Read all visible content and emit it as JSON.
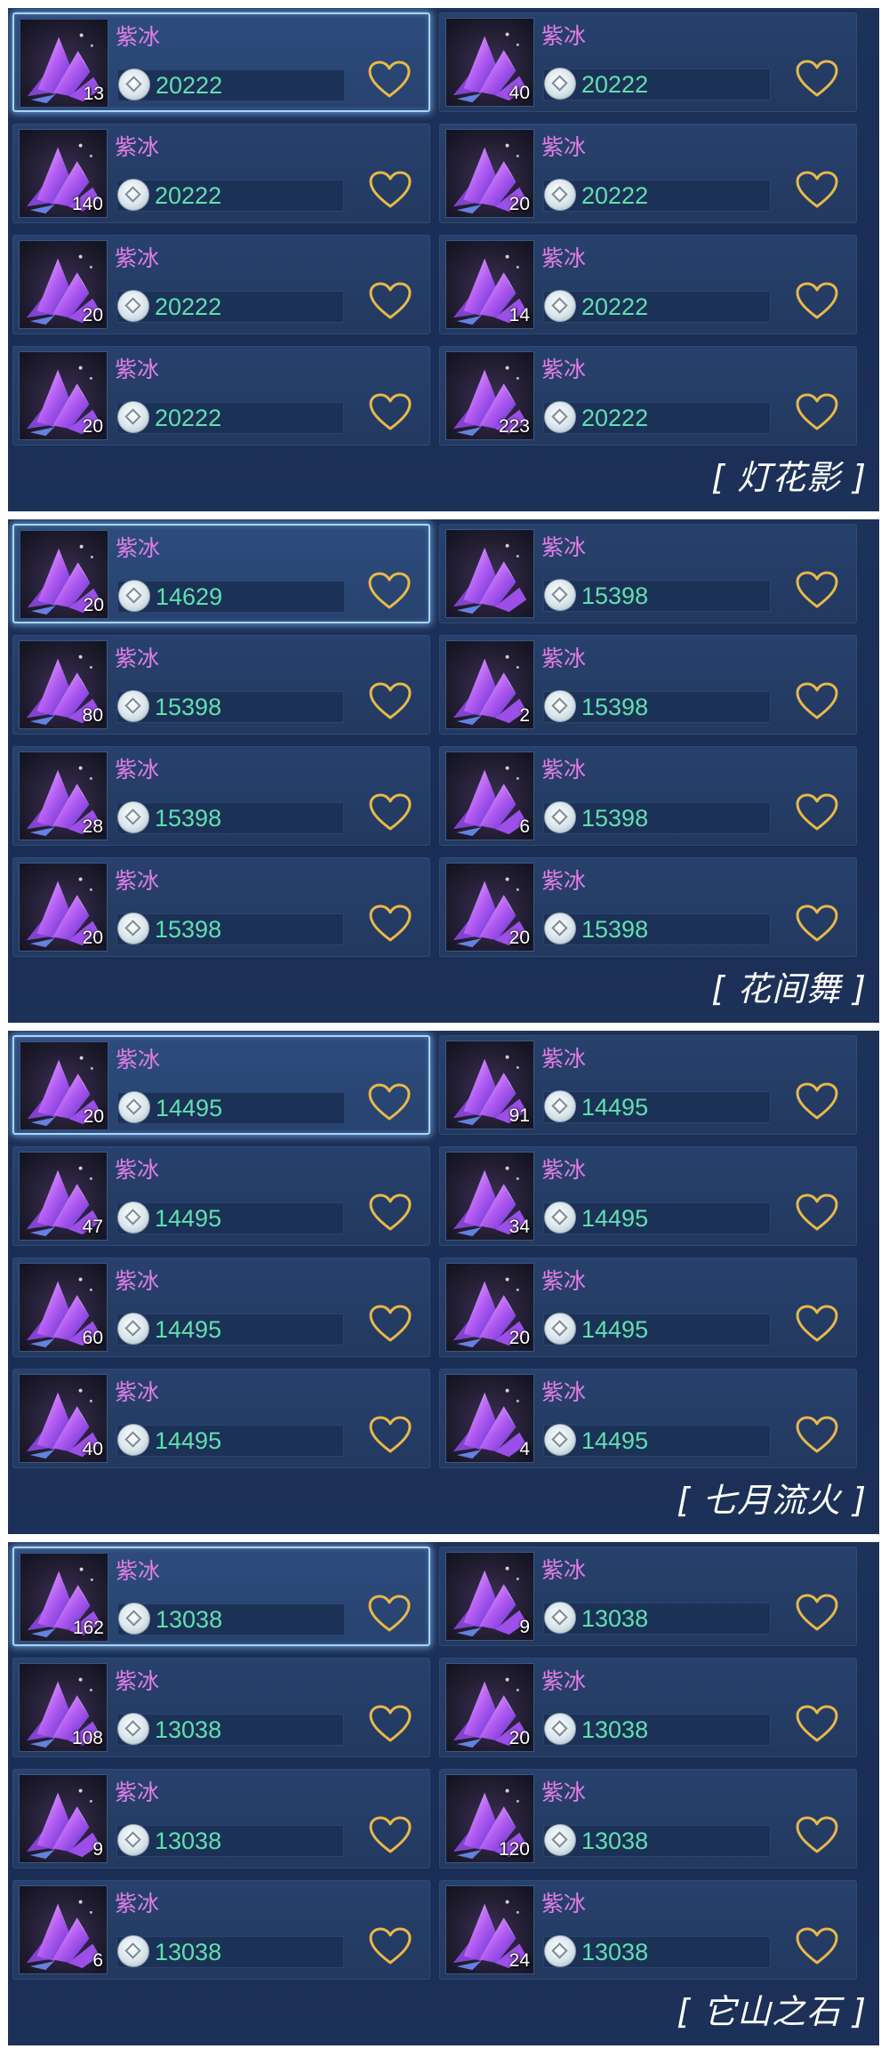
{
  "common": {
    "item_name": "紫冰",
    "icon": "purple-crystal-icon",
    "favorite_icon": "heart-outline-icon",
    "currency_icon": "coin-icon"
  },
  "colors": {
    "name": "#e17ee6",
    "price": "#5fe0b0",
    "heart": "#e8b84a",
    "panel": "#1d3259",
    "selected_border": "#a8d4ff"
  },
  "panels": [
    {
      "caption": "[ 灯花影 ]",
      "items": [
        {
          "qty": "13",
          "price": "20222",
          "selected": true
        },
        {
          "qty": "40",
          "price": "20222",
          "selected": false
        },
        {
          "qty": "140",
          "price": "20222",
          "selected": false
        },
        {
          "qty": "20",
          "price": "20222",
          "selected": false
        },
        {
          "qty": "20",
          "price": "20222",
          "selected": false
        },
        {
          "qty": "14",
          "price": "20222",
          "selected": false
        },
        {
          "qty": "20",
          "price": "20222",
          "selected": false
        },
        {
          "qty": "223",
          "price": "20222",
          "selected": false
        }
      ]
    },
    {
      "caption": "[ 花间舞 ]",
      "items": [
        {
          "qty": "20",
          "price": "14629",
          "selected": true
        },
        {
          "qty": "",
          "price": "15398",
          "selected": false
        },
        {
          "qty": "80",
          "price": "15398",
          "selected": false
        },
        {
          "qty": "2",
          "price": "15398",
          "selected": false
        },
        {
          "qty": "28",
          "price": "15398",
          "selected": false
        },
        {
          "qty": "6",
          "price": "15398",
          "selected": false
        },
        {
          "qty": "20",
          "price": "15398",
          "selected": false
        },
        {
          "qty": "20",
          "price": "15398",
          "selected": false
        }
      ]
    },
    {
      "caption": "[ 七月流火 ]",
      "items": [
        {
          "qty": "20",
          "price": "14495",
          "selected": true
        },
        {
          "qty": "91",
          "price": "14495",
          "selected": false
        },
        {
          "qty": "47",
          "price": "14495",
          "selected": false
        },
        {
          "qty": "34",
          "price": "14495",
          "selected": false
        },
        {
          "qty": "60",
          "price": "14495",
          "selected": false
        },
        {
          "qty": "20",
          "price": "14495",
          "selected": false
        },
        {
          "qty": "40",
          "price": "14495",
          "selected": false
        },
        {
          "qty": "4",
          "price": "14495",
          "selected": false
        }
      ]
    },
    {
      "caption": "[ 它山之石 ]",
      "items": [
        {
          "qty": "162",
          "price": "13038",
          "selected": true
        },
        {
          "qty": "9",
          "price": "13038",
          "selected": false
        },
        {
          "qty": "108",
          "price": "13038",
          "selected": false
        },
        {
          "qty": "20",
          "price": "13038",
          "selected": false
        },
        {
          "qty": "9",
          "price": "13038",
          "selected": false
        },
        {
          "qty": "120",
          "price": "13038",
          "selected": false
        },
        {
          "qty": "6",
          "price": "13038",
          "selected": false
        },
        {
          "qty": "24",
          "price": "13038",
          "selected": false
        }
      ]
    }
  ]
}
